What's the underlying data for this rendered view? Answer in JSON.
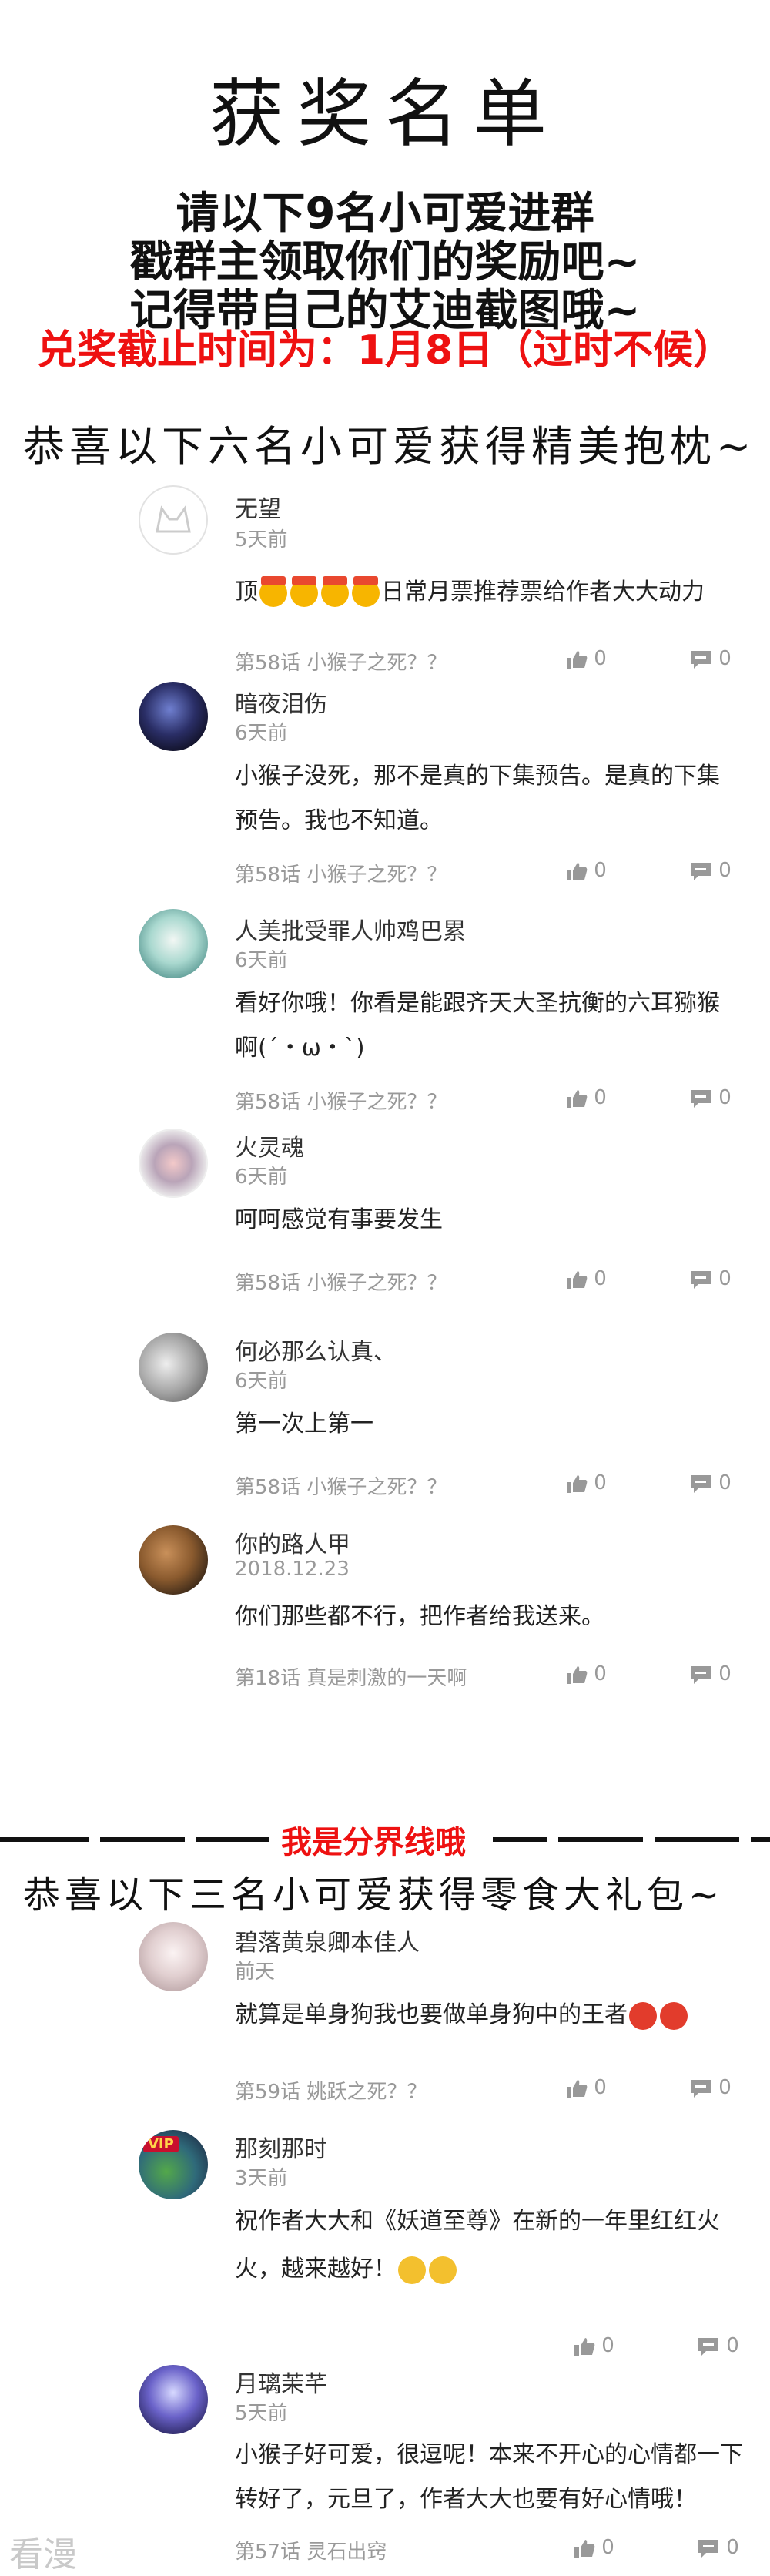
{
  "header": {
    "title": "获奖名单",
    "line1": "请以下9名小可爱进群",
    "line2": "戳群主领取你们的奖励吧~",
    "line3": "记得带自己的艾迪截图哦~",
    "deadline": "兑奖截止时间为：1月8日（过时不候）"
  },
  "section1": {
    "title": "恭喜以下六名小可爱获得精美抱枕~"
  },
  "section2": {
    "title": "恭喜以下三名小可爱获得零食大礼包~"
  },
  "divider": {
    "label": "我是分界线哦"
  },
  "comments": [
    {
      "name": "无望",
      "time": "5天前",
      "text": "顶",
      "text_after": "日常月票推荐票给作者大大动力",
      "meta": "第58话 小猴子之死？？",
      "likes": "0",
      "replies": "0"
    },
    {
      "name": "暗夜泪伤",
      "time": "6天前",
      "text": "小猴子没死，那不是真的下集预告。是真的下集预告。我也不知道。",
      "meta": "第58话 小猴子之死？？",
      "likes": "0",
      "replies": "0"
    },
    {
      "name": "人美批受罪人帅鸡巴累",
      "time": "6天前",
      "text": "看好你哦！你看是能跟齐天大圣抗衡的六耳猕猴啊(´・ω・`)",
      "meta": "第58话 小猴子之死？？",
      "likes": "0",
      "replies": "0"
    },
    {
      "name": "火灵魂",
      "time": "6天前",
      "text": "呵呵感觉有事要发生",
      "meta": "第58话 小猴子之死？？",
      "likes": "0",
      "replies": "0"
    },
    {
      "name": "何必那么认真、",
      "time": "6天前",
      "text": "第一次上第一",
      "meta": "第58话 小猴子之死？？",
      "likes": "0",
      "replies": "0"
    },
    {
      "name": "你的路人甲",
      "time": "2018.12.23",
      "text": "你们那些都不行，把作者给我送来。",
      "meta": "第18话 真是刺激的一天啊",
      "likes": "0",
      "replies": "0"
    },
    {
      "name": "碧落黄泉卿本佳人",
      "time": "前天",
      "text": "就算是单身狗我也要做单身狗中的王者",
      "meta": "第59话 姚跃之死？？",
      "likes": "0",
      "replies": "0"
    },
    {
      "name": "那刻那时",
      "time": "3天前",
      "text": "祝作者大大和《妖道至尊》在新的一年里红红火火，越来越好！",
      "meta": "",
      "likes": "0",
      "replies": "0"
    },
    {
      "name": "月璃茉芊",
      "time": "5天前",
      "text": "小猴子好可爱，很逗呢！本来不开心的心情都一下转好了，元旦了，作者大大也要有好心情哦！",
      "meta": "第57话 灵石出窍",
      "likes": "0",
      "replies": "0"
    }
  ],
  "watermark": "看漫"
}
